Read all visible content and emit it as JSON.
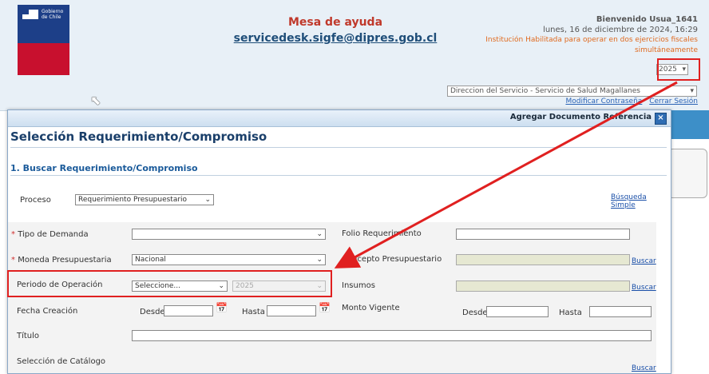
{
  "header": {
    "logo_text": "Gobierno de Chile",
    "help_title": "Mesa de ayuda",
    "help_email": "servicedesk.sigfe@dipres.gob.cl",
    "welcome": "Bienvenido Usua_1641",
    "date": "lunes, 16 de diciembre de 2024, 16:29",
    "institution_note_1": "Institución Habilitada para operar en dos ejercicios fiscales",
    "institution_note_2": "simultáneamente",
    "year_value": "2025",
    "service_value": "Direccion del Servicio - Servicio de Salud Magallanes",
    "change_password": "Modificar Contraseña",
    "logout": "Cerrar Sesión"
  },
  "modal": {
    "caption": "Agregar Documento Referencia",
    "close_symbol": "×",
    "page_title": "Selección Requerimiento/Compromiso",
    "section_title": "1. Buscar Requerimiento/Compromiso",
    "proceso_label": "Proceso",
    "proceso_value": "Requerimiento Presupuestario",
    "busqueda_simple": "Búsqueda Simple",
    "tipo_demanda_label": "Tipo de Demanda",
    "tipo_demanda_value": "",
    "folio_label": "Folio Requerimiento",
    "folio_value": "",
    "moneda_label": "Moneda Presupuestaria",
    "moneda_value": "Nacional",
    "concepto_label": "Concepto Presupuestario",
    "periodo_label": "Periodo de Operación",
    "periodo_value": "Seleccione...",
    "periodo_year": "2025",
    "insumos_label": "Insumos",
    "fecha_label": "Fecha Creación",
    "desde": "Desde",
    "hasta": "Hasta",
    "monto_label": "Monto Vigente",
    "titulo_label": "Título",
    "catalogo_label": "Selección de Catálogo",
    "buscar": "Buscar",
    "required_mark": "*"
  },
  "colors": {
    "highlight": "#e02020",
    "title": "#1a3f6a",
    "link": "#1a4fa8"
  },
  "icons": {
    "calendar": "calendar-icon",
    "cursor": "mouse-pointer-icon"
  }
}
